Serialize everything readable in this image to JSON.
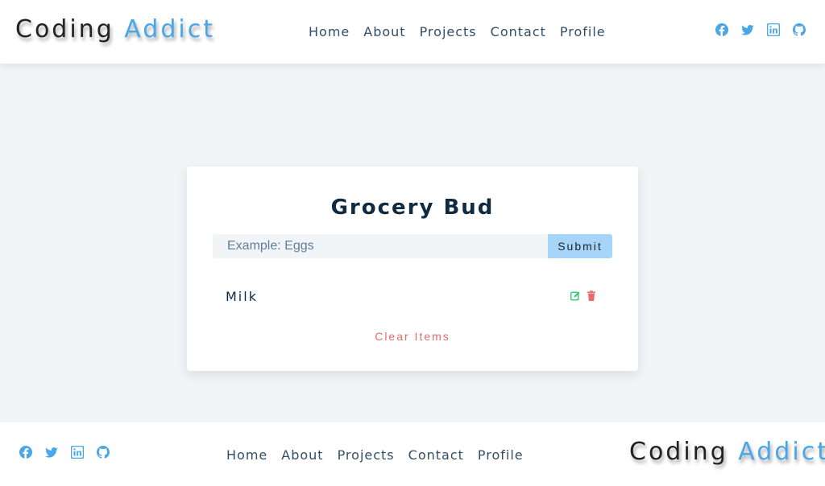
{
  "brand": {
    "first": "Coding",
    "second": "Addict"
  },
  "nav": {
    "items": [
      "Home",
      "About",
      "Projects",
      "Contact",
      "Profile"
    ]
  },
  "socials": [
    "facebook-icon",
    "twitter-icon",
    "linkedin-icon",
    "github-icon"
  ],
  "colors": {
    "accent": "#49a6e9",
    "heading": "#102a42",
    "danger": "#e66b6b",
    "edit": "#2ecc71",
    "submit": "#a5d5f8"
  },
  "app": {
    "title": "Grocery Bud",
    "input_placeholder": "Example: Eggs",
    "input_value": "",
    "submit_label": "Submit",
    "items": [
      {
        "title": "Milk",
        "actions": [
          "edit-icon",
          "trash-icon"
        ]
      }
    ],
    "clear_label": "Clear Items"
  }
}
